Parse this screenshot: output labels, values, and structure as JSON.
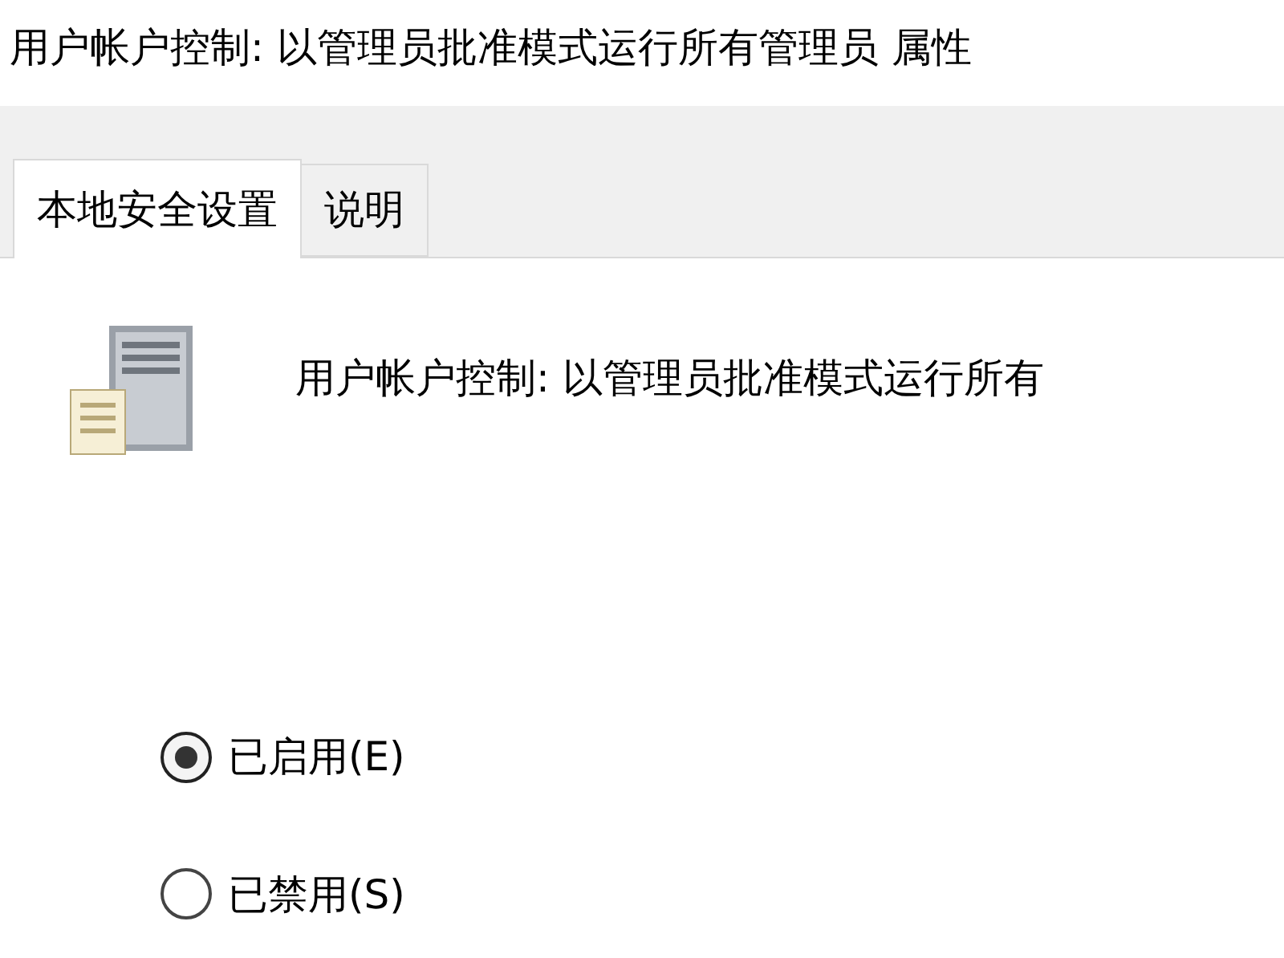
{
  "window": {
    "title": "用户帐户控制: 以管理员批准模式运行所有管理员 属性"
  },
  "tabs": [
    {
      "label": "本地安全设置",
      "selected": true
    },
    {
      "label": "说明",
      "selected": false
    }
  ],
  "policy": {
    "name": "用户帐户控制: 以管理员批准模式运行所有"
  },
  "options": [
    {
      "label": "已启用(E)",
      "selected": true
    },
    {
      "label": "已禁用(S)",
      "selected": false
    }
  ]
}
